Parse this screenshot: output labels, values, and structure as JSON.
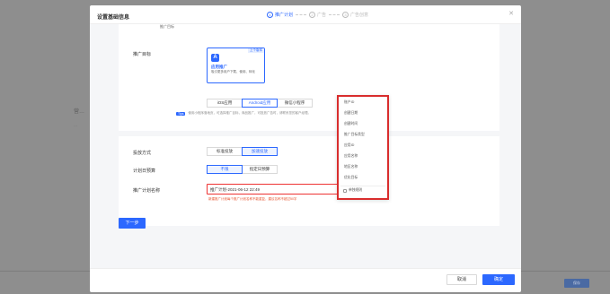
{
  "background": {
    "left_label": "营…",
    "left_sub": "…",
    "right_button": "保存"
  },
  "modal": {
    "title": "设置基础信息",
    "close_icon": "close-icon",
    "steps": [
      {
        "num": "1",
        "label": "推广计划",
        "active": true
      },
      {
        "num": "2",
        "label": "广告",
        "active": false
      },
      {
        "num": "3",
        "label": "广告创意",
        "active": false
      }
    ]
  },
  "section1": {
    "top_cut_label": "推广目标",
    "goal_label": "推广目标",
    "goal_card": {
      "tag": "上个版本",
      "icon": "A",
      "title": "应用推广",
      "desc": "吸引更多用户下载、使用、转化"
    },
    "platform_options": [
      "iOS应用",
      "Android应用",
      "微信小程序"
    ],
    "platform_selected": "Android应用",
    "tips_tag": "Tips",
    "tips_text": "使用小程序落地页，可选择推广目标，商品推广，可投放广告时，请联系您的客户经理。"
  },
  "section2": {
    "delivery_label": "投放方式",
    "delivery_options": [
      "标准投放",
      "加速投放"
    ],
    "delivery_selected": "加速投放",
    "budget_label": "计划日预算",
    "budget_options": [
      "不限",
      "指定日预算"
    ],
    "budget_selected": "不限",
    "name_label": "推广计划名称",
    "name_value": "推广计划-2021-06-12 22:49",
    "name_count": "15/50",
    "name_error": "新建推广计划每个推广计划名称不能重复，建议名称不超过50字"
  },
  "dropdown": {
    "items": [
      "账户ID",
      "创建日期",
      "创建时间",
      "推广目标类型",
      "应用ID",
      "应用名称",
      "地区名称",
      "优化目标"
    ],
    "checkbox_label": "单独规则"
  },
  "buttons": {
    "next": "下一步",
    "cancel": "取消",
    "confirm": "确定"
  },
  "colors": {
    "primary": "#2c68ff",
    "error": "#d92d2d"
  }
}
